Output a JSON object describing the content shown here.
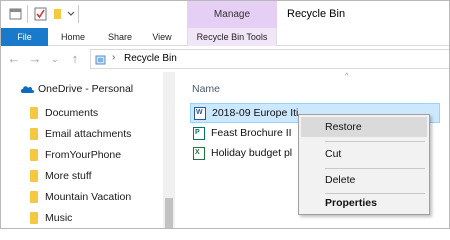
{
  "title": {
    "manage_label": "Manage",
    "window_title": "Recycle Bin"
  },
  "ribbon": {
    "tabs": [
      "File",
      "Home",
      "Share",
      "View",
      "Recycle Bin Tools"
    ]
  },
  "address": {
    "path": "Recycle Bin"
  },
  "nav": {
    "root_label": "OneDrive - Personal",
    "folders": [
      "Documents",
      "Email attachments",
      "FromYourPhone",
      "More stuff",
      "Mountain Vacation",
      "Music"
    ]
  },
  "content": {
    "column_header": "Name",
    "files": [
      {
        "name": "2018-09 Europe Iti",
        "icon": "word-doc-icon",
        "selected": true
      },
      {
        "name": "Feast Brochure II",
        "icon": "publisher-doc-icon",
        "selected": false
      },
      {
        "name": "Holiday budget pl",
        "icon": "excel-doc-icon",
        "selected": false
      }
    ]
  },
  "context_menu": {
    "items": [
      "Restore",
      "Cut",
      "Delete",
      "Properties"
    ]
  },
  "colors": {
    "file_tab": "#1979ca",
    "manage_tab": "#e6cff5",
    "selection": "#cce8ff",
    "folder": "#f5c842",
    "onedrive": "#0f6cbd"
  }
}
